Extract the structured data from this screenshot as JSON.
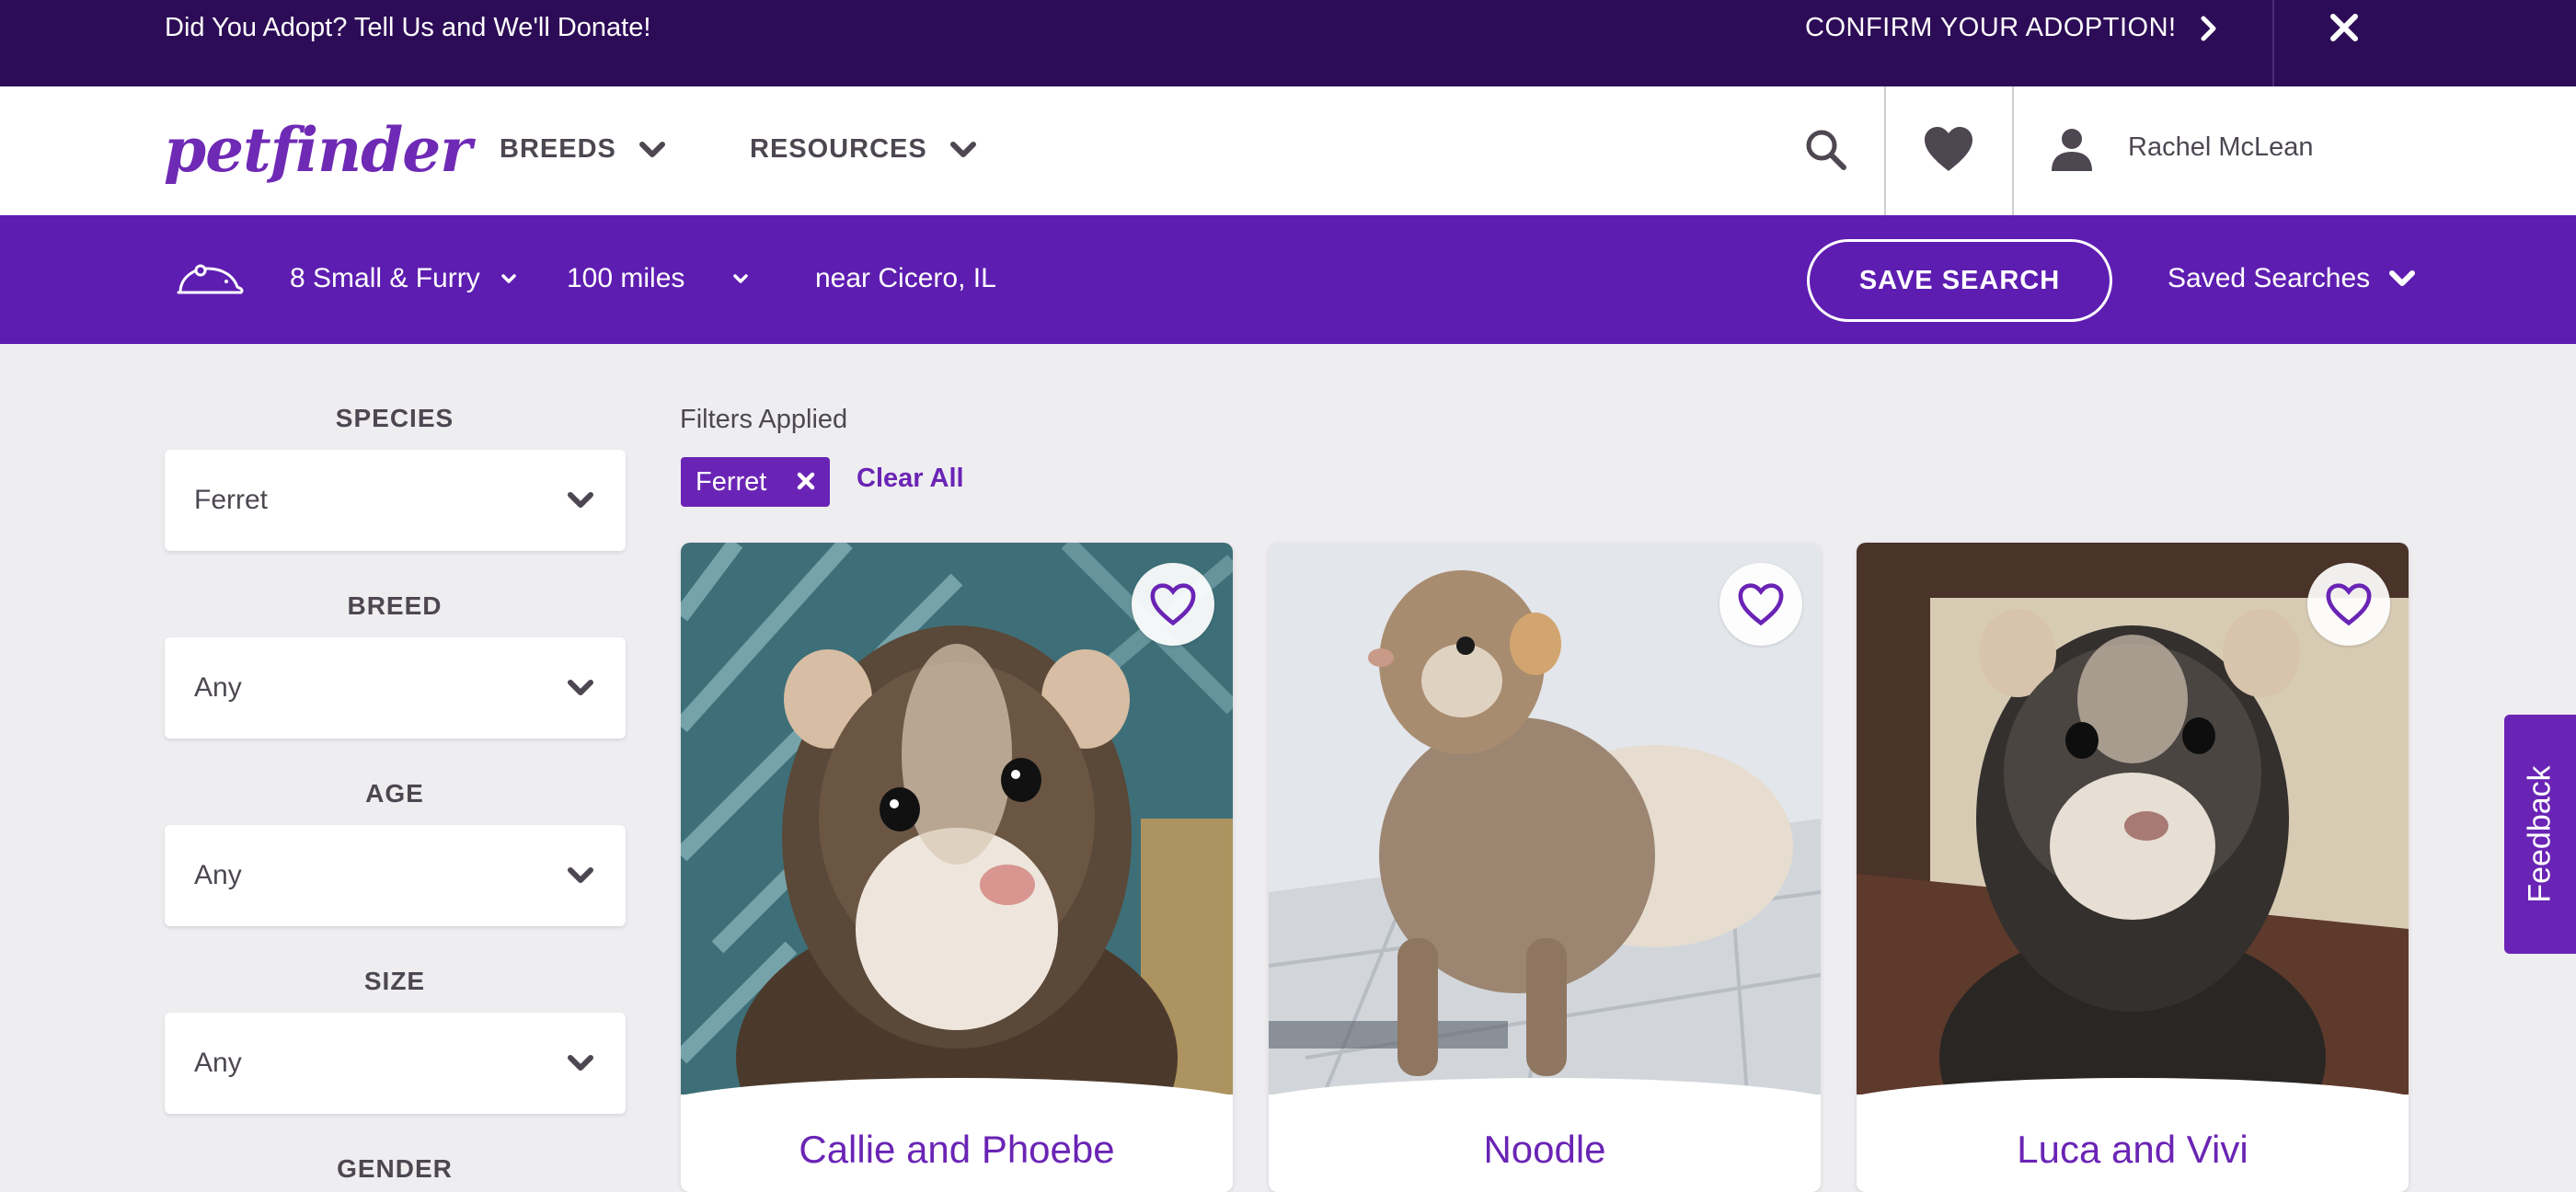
{
  "promo": {
    "text": "Did You Adopt? Tell Us and We'll Donate!",
    "confirm_label": "CONFIRM YOUR ADOPTION!"
  },
  "header": {
    "logo": "petfinder",
    "nav": [
      {
        "label": "BREEDS"
      },
      {
        "label": "RESOURCES"
      }
    ],
    "user_name": "Rachel McLean"
  },
  "searchbar": {
    "animal_type": "8 Small & Furry",
    "distance": "100 miles",
    "location": "near Cicero, IL",
    "save_search_label": "SAVE SEARCH",
    "saved_searches_label": "Saved Searches"
  },
  "filters": [
    {
      "label": "SPECIES",
      "value": "Ferret"
    },
    {
      "label": "BREED",
      "value": "Any"
    },
    {
      "label": "AGE",
      "value": "Any"
    },
    {
      "label": "SIZE",
      "value": "Any"
    },
    {
      "label": "GENDER",
      "value": ""
    }
  ],
  "applied": {
    "title": "Filters Applied",
    "chips": [
      {
        "label": "Ferret"
      }
    ],
    "clear_all_label": "Clear All"
  },
  "results": [
    {
      "name": "Callie and Phoebe"
    },
    {
      "name": "Noodle"
    },
    {
      "name": "Luca and Vivi"
    }
  ],
  "feedback_label": "Feedback",
  "colors": {
    "promo_bg": "#2d0c57",
    "searchbar_bg": "#5e1db1",
    "accent": "#6a24b5",
    "page_bg": "#eeedf0"
  }
}
